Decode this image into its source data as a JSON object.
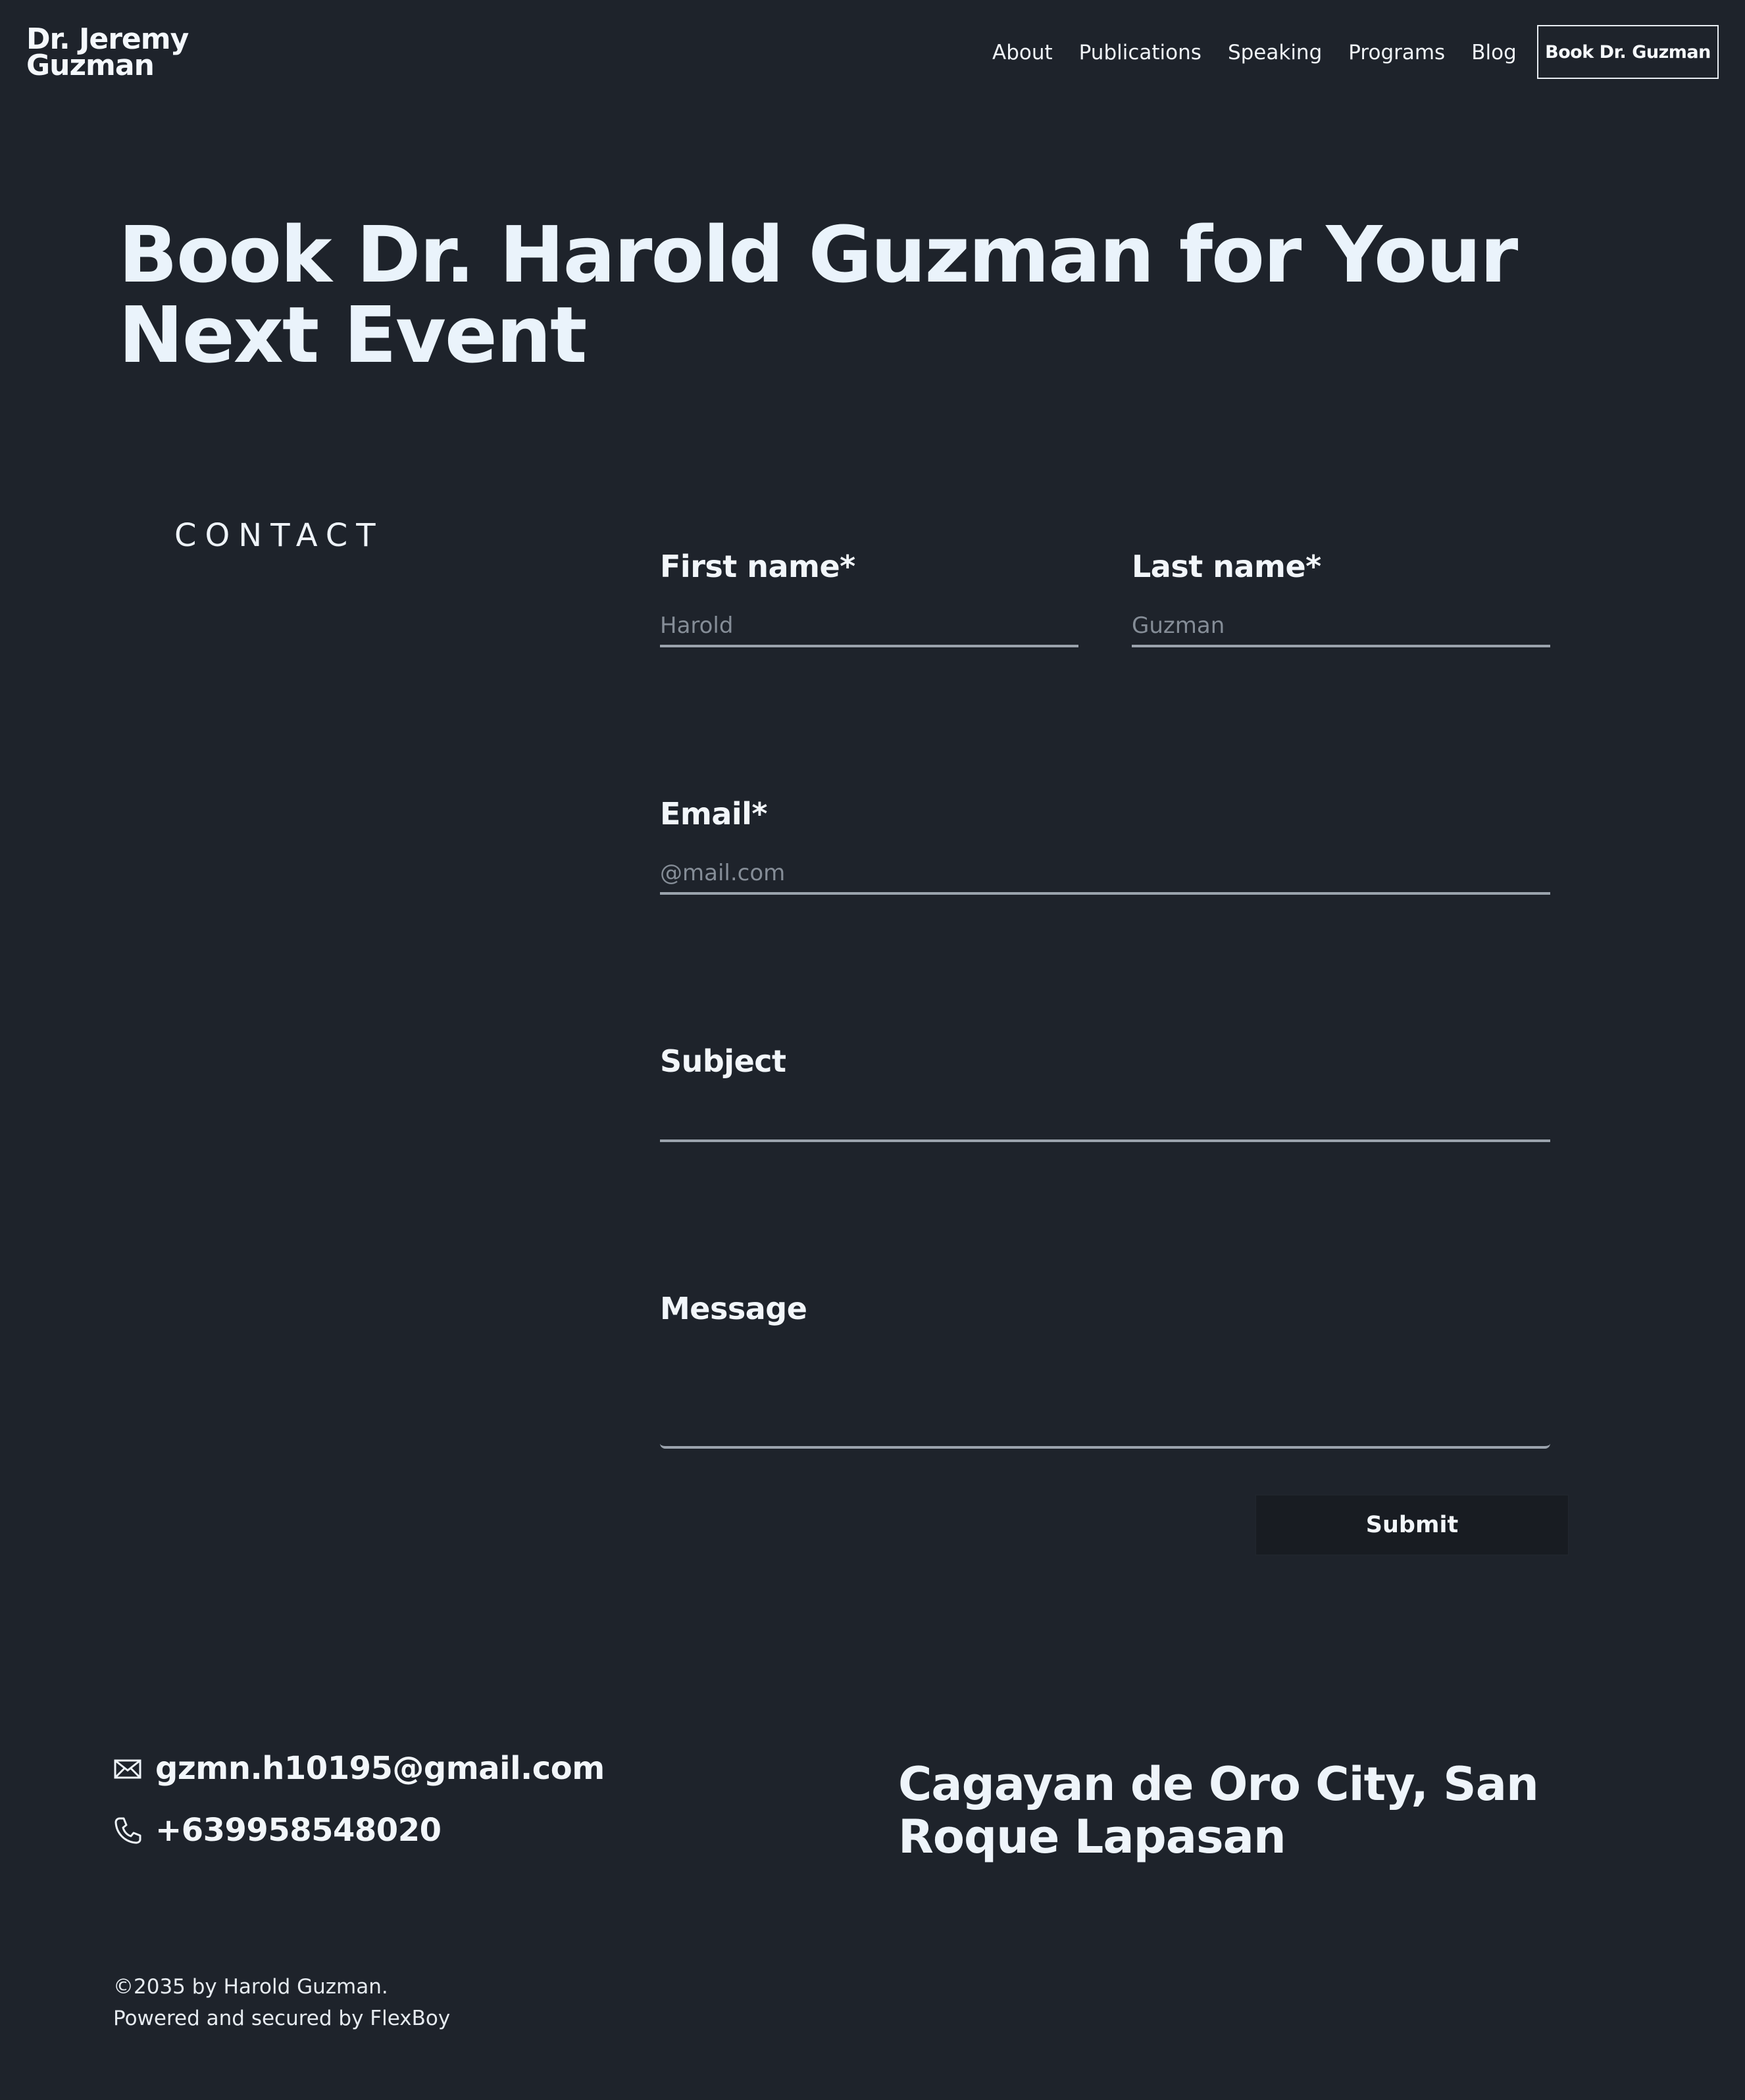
{
  "header": {
    "logo_line1": "Dr. Jeremy",
    "logo_line2": "Guzman",
    "nav": [
      "About",
      "Publications",
      "Speaking",
      "Programs",
      "Blog"
    ],
    "cta_label": "Book Dr. Guzman"
  },
  "hero": {
    "title": "Book Dr. Harold Guzman for Your Next Event"
  },
  "contact": {
    "section_label": "CONTACT",
    "form": {
      "first_name": {
        "label": "First name*",
        "placeholder": "Harold"
      },
      "last_name": {
        "label": "Last name*",
        "placeholder": "Guzman"
      },
      "email": {
        "label": "Email*",
        "placeholder": "@mail.com"
      },
      "subject": {
        "label": "Subject",
        "placeholder": ""
      },
      "message": {
        "label": "Message",
        "placeholder": ""
      },
      "submit_label": "Submit"
    }
  },
  "footer": {
    "email": "gzmn.h10195@gmail.com",
    "email_icon": "envelope-icon",
    "phone": "+639958548020",
    "phone_icon": "phone-icon",
    "address": "Cagayan de Oro City, San Roque Lapasan",
    "copyright_line1": "©2035 by Harold Guzman.",
    "copyright_line2": "Powered and secured by FlexBoy"
  },
  "colors": {
    "background": "#1e232b",
    "text": "#eef3f8",
    "input_underline": "#9ba3ad",
    "submit_background": "#181c22"
  }
}
